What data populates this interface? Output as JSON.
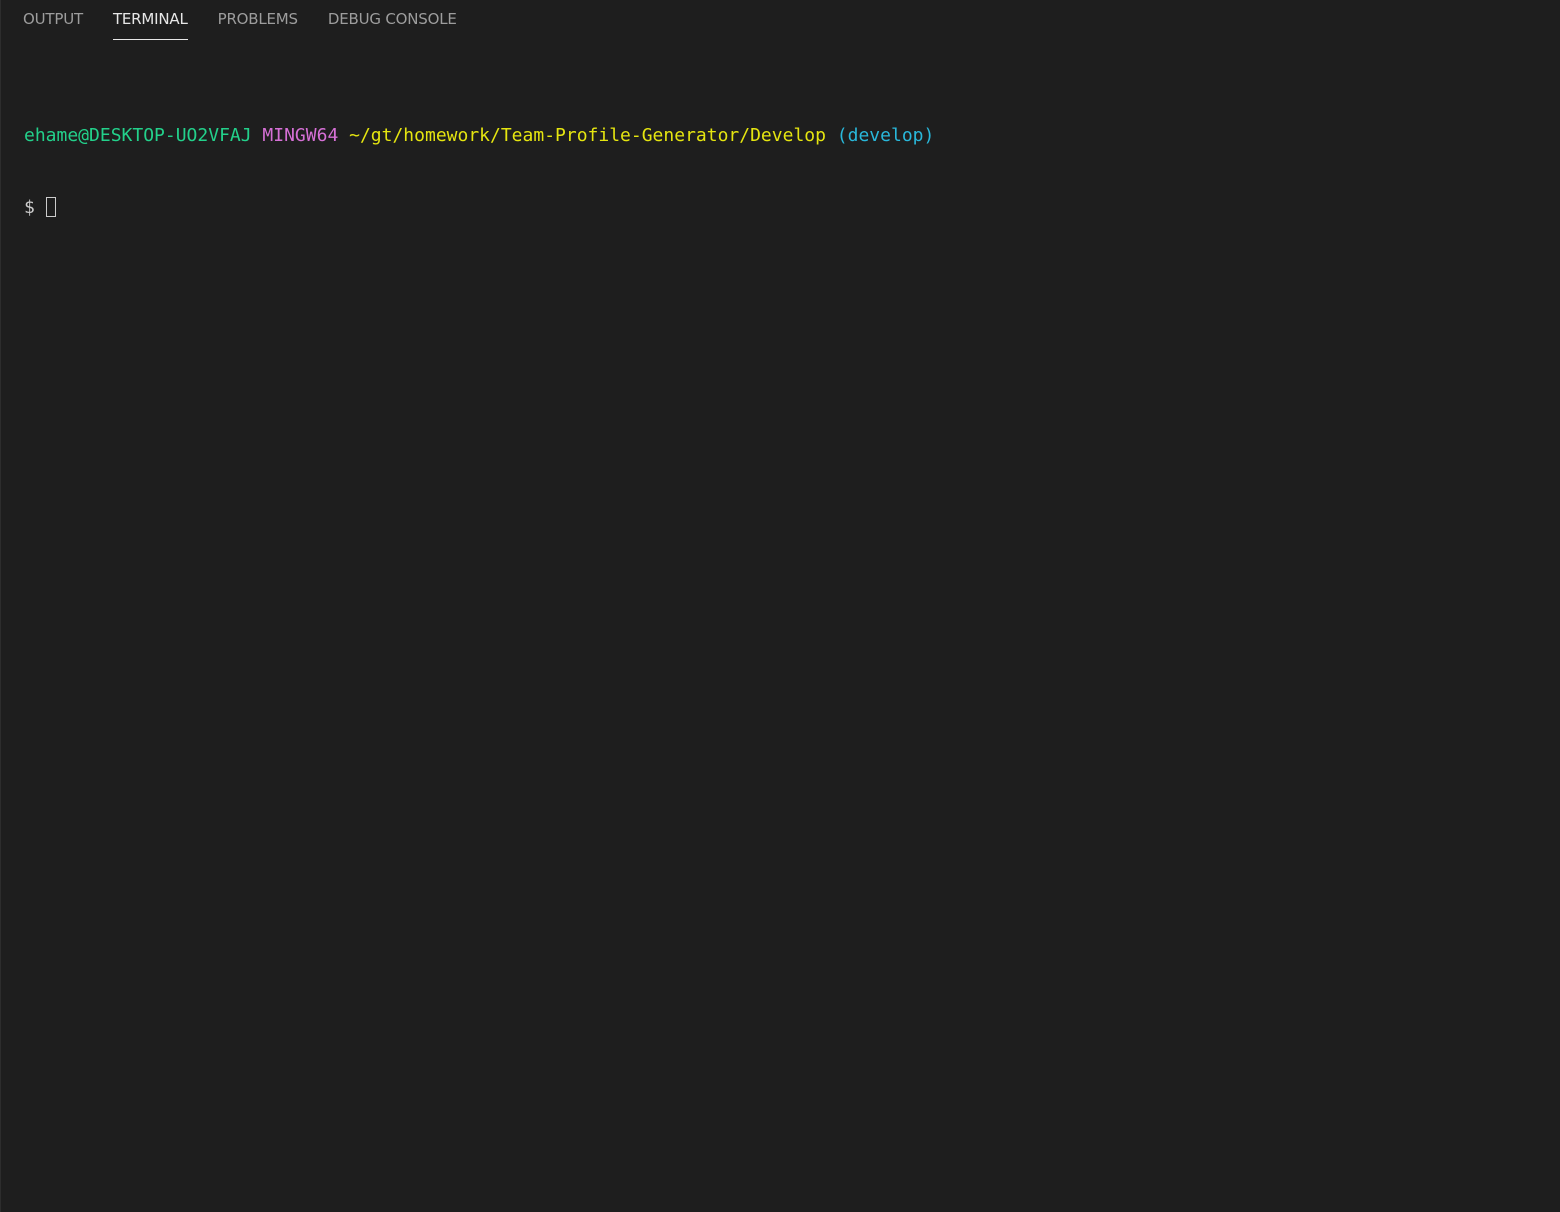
{
  "tabs": [
    {
      "label": "OUTPUT",
      "active": false
    },
    {
      "label": "TERMINAL",
      "active": true
    },
    {
      "label": "PROBLEMS",
      "active": false
    },
    {
      "label": "DEBUG CONSOLE",
      "active": false
    }
  ],
  "terminal": {
    "user_host": "ehame@DESKTOP-UO2VFAJ",
    "shell": "MINGW64",
    "path": "~/gt/homework/Team-Profile-Generator/Develop",
    "branch": "(develop)",
    "prompt_symbol": "$"
  },
  "colors": {
    "background": "#1e1e1e",
    "user_host": "#23d18b",
    "shell": "#d670d6",
    "path": "#e5e510",
    "branch": "#29b8db"
  }
}
